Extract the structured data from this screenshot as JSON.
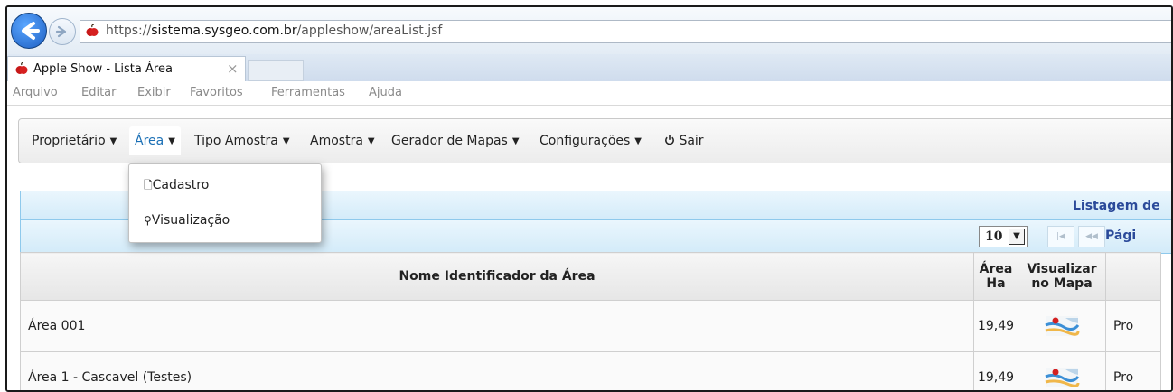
{
  "browser": {
    "url_prefix": "https://",
    "url_domain": "sistema.sysgeo.com.br",
    "url_path": "/appleshow/areaList.jsf",
    "tab_title": "Apple Show - Lista Área",
    "tab_close": "×"
  },
  "menubar": {
    "items": [
      "Arquivo",
      "Editar",
      "Exibir",
      "Favoritos",
      "Ferramentas",
      "Ajuda"
    ]
  },
  "nav": {
    "items": [
      {
        "label": "Proprietário"
      },
      {
        "label": "Área"
      },
      {
        "label": "Tipo Amostra"
      },
      {
        "label": "Amostra"
      },
      {
        "label": "Gerador de Mapas"
      },
      {
        "label": "Configurações"
      }
    ],
    "logout_label": "Sair",
    "caret": "▼"
  },
  "dropdown": {
    "items": [
      {
        "icon": "document-icon",
        "glyph": "🗋",
        "label": "Cadastro"
      },
      {
        "icon": "search-icon",
        "glyph": "⚲",
        "label": "Visualização"
      }
    ]
  },
  "listing": {
    "title": "Listagem de",
    "rows_per_page": "10",
    "page_label": "Pági",
    "first_glyph": "|◀",
    "prev_glyph": "◀◀"
  },
  "table": {
    "headers": {
      "name": "Nome Identificador da Área",
      "area_line1": "Área",
      "area_line2": "Ha",
      "map_line1": "Visualizar",
      "map_line2": "no Mapa"
    },
    "rows": [
      {
        "name": "Área 001",
        "area": "19,49",
        "extra": "Pro"
      },
      {
        "name": "Área 1 - Cascavel (Testes)",
        "area": "19,49",
        "extra": "Pro"
      }
    ]
  },
  "colors": {
    "accent": "#1a6fb5",
    "list_title": "#2b4a9a",
    "header_border": "#8ec9ec"
  }
}
